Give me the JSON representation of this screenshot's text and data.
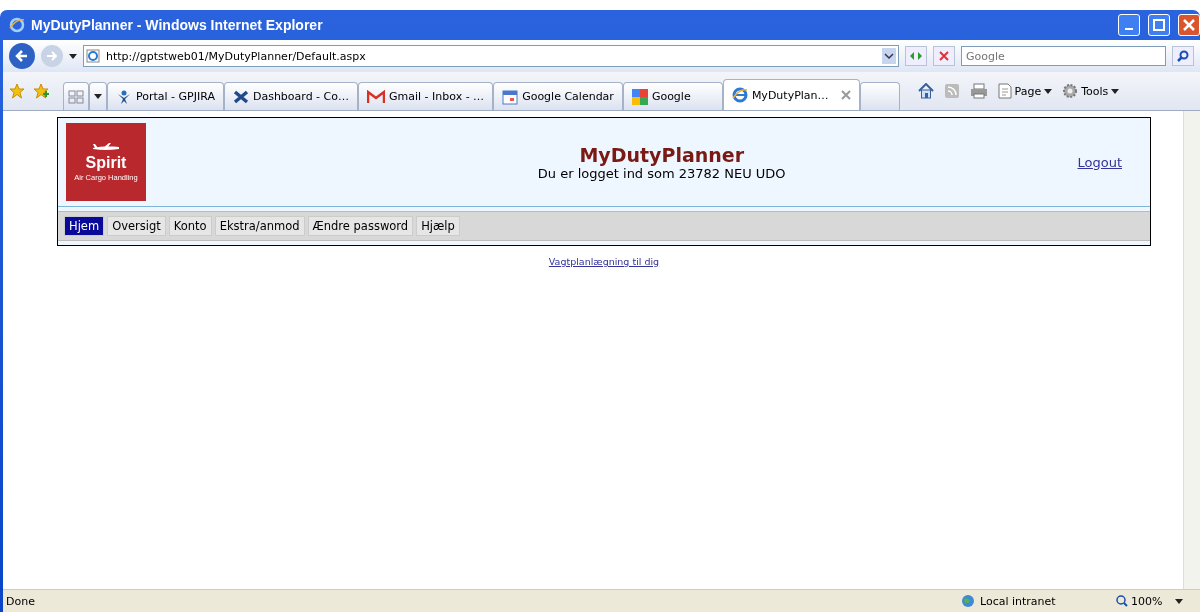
{
  "window": {
    "title": "MyDutyPlanner - Windows Internet Explorer"
  },
  "address_bar": {
    "value": "http://gptstweb01/MyDutyPlanner/Default.aspx"
  },
  "search": {
    "placeholder": "Google"
  },
  "tabs": [
    {
      "label": "Portal - GPJIRA",
      "selected": false
    },
    {
      "label": "Dashboard - Co…",
      "selected": false
    },
    {
      "label": "Gmail - Inbox - …",
      "selected": false
    },
    {
      "label": "Google Calendar",
      "selected": false
    },
    {
      "label": "Google",
      "selected": false
    },
    {
      "label": "MyDutyPlan…",
      "selected": true
    }
  ],
  "command_bar": [
    {
      "label": "Page"
    },
    {
      "label": "Tools"
    }
  ],
  "page": {
    "logo": {
      "name": "Spirit",
      "tagline": "Air Cargo Handling"
    },
    "title": "MyDutyPlanner",
    "subtitle": "Du er logget ind som 23782 NEU UDO",
    "logout": "Logout",
    "menu": [
      {
        "label": "Hjem",
        "selected": true
      },
      {
        "label": "Oversigt",
        "selected": false
      },
      {
        "label": "Konto",
        "selected": false
      },
      {
        "label": "Ekstra/anmod",
        "selected": false
      },
      {
        "label": "Ændre password",
        "selected": false
      },
      {
        "label": "Hjælp",
        "selected": false
      }
    ],
    "link": "Vagtplanlægning til dig"
  },
  "status_bar": {
    "status": "Done",
    "zone": "Local intranet",
    "zoom": "100%"
  }
}
